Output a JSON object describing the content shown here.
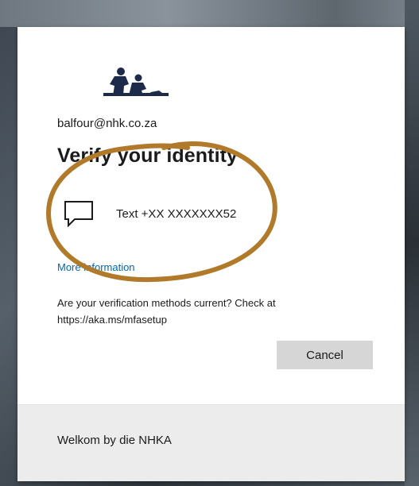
{
  "account": {
    "email": "balfour@nhk.co.za"
  },
  "dialog": {
    "title": "Verify your identity",
    "method_label": "Text +XX XXXXXXX52",
    "method_icon": "chat-bubble-icon",
    "more_info": "More information",
    "note": "Are your verification methods current? Check at https://aka.ms/mfasetup",
    "cancel_label": "Cancel"
  },
  "footer": {
    "text": "Welkom by die NHKA"
  },
  "colors": {
    "link": "#0067b8",
    "logo": "#1e2a4a",
    "annotation_circle": "#b07a2a",
    "button_bg": "#d6d6d6",
    "footer_bg": "#ececec"
  }
}
